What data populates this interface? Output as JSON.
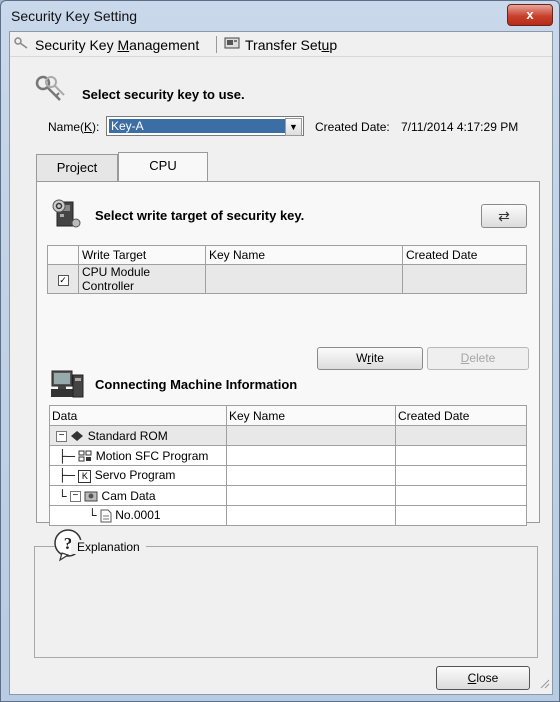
{
  "window": {
    "title": "Security Key Setting",
    "close_glyph": "x"
  },
  "menu": {
    "management": {
      "pre": "Security Key ",
      "mnemonic": "M",
      "post": "anagement"
    },
    "transfer": {
      "pre": "Transfer Set",
      "mnemonic": "u",
      "post": "p"
    }
  },
  "instruction": "Select security key to use.",
  "name_field": {
    "label_pre": "Name(",
    "label_key": "K",
    "label_post": "):",
    "value": "Key-A"
  },
  "created": {
    "label": "Created Date:",
    "value": "7/11/2014 4:17:29 PM"
  },
  "tabs": [
    {
      "label": "Project"
    },
    {
      "label": "CPU"
    }
  ],
  "cpu_panel": {
    "heading": "Select write target of security key.",
    "columns": [
      "",
      "Write Target",
      "Key Name",
      "Created Date"
    ],
    "rows": [
      {
        "checked": true,
        "target": "CPU Module Controller",
        "key_name": "",
        "created": ""
      }
    ],
    "write_button": {
      "pre": "W",
      "mnemonic": "r",
      "post": "ite"
    },
    "delete_button": {
      "pre": "",
      "mnemonic": "D",
      "post": "elete"
    }
  },
  "machine": {
    "heading": "Connecting Machine Information",
    "columns": [
      "Data",
      "Key Name",
      "Created Date"
    ],
    "rows": [
      {
        "label": "Standard ROM",
        "key_name": "",
        "created": ""
      },
      {
        "label": "Motion SFC Program",
        "key_name": "",
        "created": ""
      },
      {
        "label": "Servo Program",
        "key_name": "",
        "created": ""
      },
      {
        "label": "Cam Data",
        "key_name": "",
        "created": ""
      },
      {
        "label": "No.0001",
        "key_name": "",
        "created": ""
      }
    ]
  },
  "explanation": {
    "label": "Explanation",
    "text": ""
  },
  "close_button": {
    "pre": "",
    "mnemonic": "C",
    "post": "lose"
  },
  "colors": {
    "selection": "#3a6ea5",
    "title_bar": "#b7cbe2",
    "close_red": "#c8412d"
  }
}
